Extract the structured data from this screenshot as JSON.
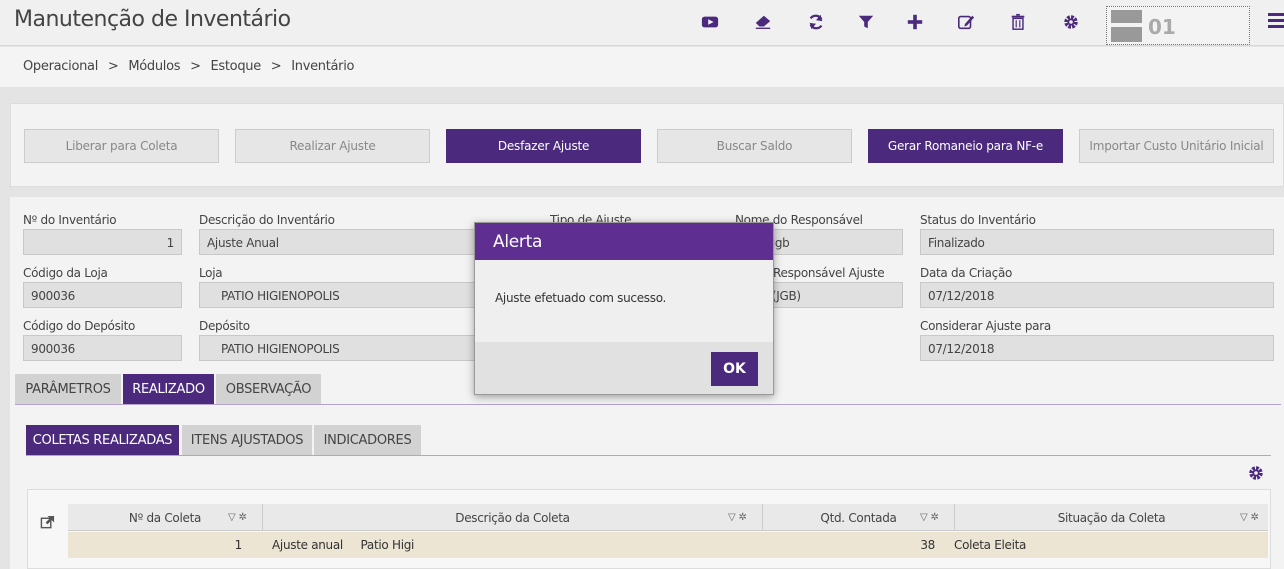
{
  "header": {
    "title": "Manutenção de Inventário",
    "company_number": "01",
    "toolbar_icons": [
      "video-icon",
      "eraser-icon",
      "refresh-icon",
      "filter-icon",
      "plus-icon",
      "edit-icon",
      "trash-icon",
      "gear-icon"
    ]
  },
  "breadcrumb": [
    "Operacional",
    ">",
    "Módulos",
    ">",
    "Estoque",
    ">",
    "Inventário"
  ],
  "actions": {
    "liberar": "Liberar para Coleta",
    "realizar": "Realizar Ajuste",
    "desfazer": "Desfazer Ajuste",
    "buscar": "Buscar Saldo",
    "gerar": "Gerar Romaneio para NF-e",
    "importar": "Importar Custo Unitário Inicial"
  },
  "form": {
    "num_inventario_label": "Nº do Inventário",
    "num_inventario": "1",
    "descricao_label": "Descrição do Inventário",
    "descricao": "Ajuste Anual",
    "tipo_ajuste_label": "Tipo de Ajuste",
    "responsavel_label": "Nome do Responsável",
    "responsavel": "n.jgb",
    "status_label": "Status do Inventário",
    "status": "Finalizado",
    "cod_loja_label": "Código da Loja",
    "cod_loja": "900036",
    "loja_label": "Loja",
    "loja": "PATIO HIGIENOPOLIS",
    "resp_ajuste_label": "Responsável Ajuste",
    "resp_ajuste": "n (JGB)",
    "data_criacao_label": "Data da Criação",
    "data_criacao": "07/12/2018",
    "cod_deposito_label": "Código do Depósito",
    "cod_deposito": "900036",
    "deposito_label": "Depósito",
    "deposito": "PATIO HIGIENOPOLIS",
    "considerar_label": "Considerar Ajuste para",
    "considerar": "07/12/2018"
  },
  "tabs": {
    "parametros": "PARÂMETROS",
    "realizado": "REALIZADO",
    "observacao": "OBSERVAÇÃO"
  },
  "subtabs": {
    "coletas": "COLETAS REALIZADAS",
    "itens": "ITENS AJUSTADOS",
    "indicadores": "INDICADORES"
  },
  "grid": {
    "columns": [
      "Nº da Coleta",
      "Descrição da Coleta",
      "Qtd. Contada",
      "Situação da Coleta"
    ],
    "rows": [
      {
        "num": "1",
        "descricao": "Ajuste anual     Patio Higi",
        "qtd": "38",
        "situacao": "Coleta Eleita"
      }
    ]
  },
  "modal": {
    "title": "Alerta",
    "message": "Ajuste efetuado com sucesso.",
    "ok": "OK"
  },
  "colors": {
    "primary": "#4b2a7e",
    "modal_header": "#5e2f91"
  }
}
